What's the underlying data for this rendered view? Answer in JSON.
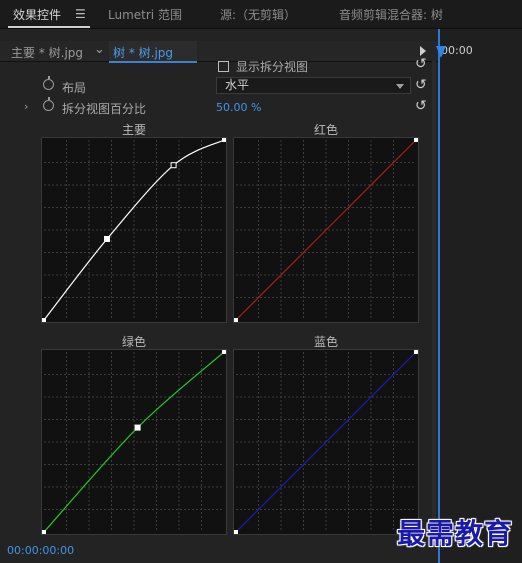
{
  "tabs": [
    {
      "label": "效果控件"
    },
    {
      "label": "Lumetri 范围"
    },
    {
      "label": "源:（无剪辑）"
    },
    {
      "label": "音频剪辑混合器: 树"
    }
  ],
  "source_bar": {
    "master_clip": "主要 * 树.jpg",
    "active_clip": "树 * 树.jpg",
    "timeline_time": "00:00"
  },
  "properties": {
    "split_view_label": "显示拆分视图",
    "layout_label": "布局",
    "layout_value": "水平",
    "split_percent_label": "拆分视图百分比",
    "split_percent_value": "50.00 %"
  },
  "curves": [
    {
      "title": "主要",
      "color": "#ffffff",
      "points": [
        [
          0,
          0
        ],
        [
          0.35,
          0.45
        ],
        [
          0.72,
          0.86
        ],
        [
          1,
          1
        ]
      ]
    },
    {
      "title": "红色",
      "color": "#b01818",
      "points": [
        [
          0,
          0
        ],
        [
          1,
          1
        ]
      ]
    },
    {
      "title": "绿色",
      "color": "#22c822",
      "points": [
        [
          0,
          0
        ],
        [
          0.52,
          0.58
        ],
        [
          1,
          1
        ]
      ]
    },
    {
      "title": "蓝色",
      "color": "#1c1cb8",
      "points": [
        [
          0,
          0
        ],
        [
          1,
          1
        ]
      ]
    }
  ],
  "footer": {
    "timecode": "00:00:00:00"
  },
  "watermark": "最需教育"
}
